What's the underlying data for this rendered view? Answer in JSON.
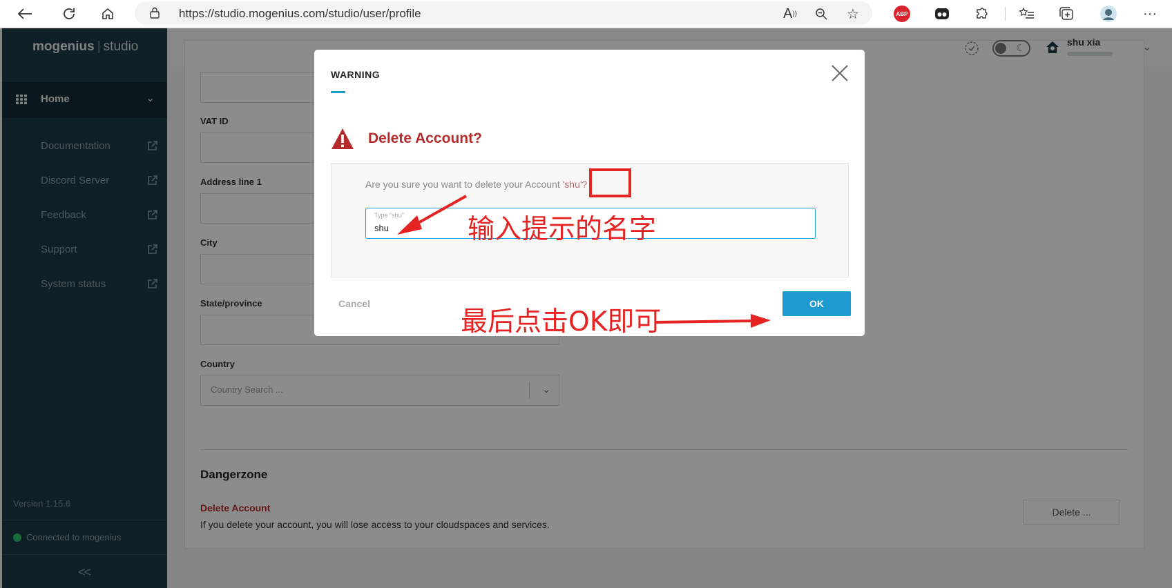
{
  "browser": {
    "url": "https://studio.mogenius.com/studio/user/profile"
  },
  "sidebar": {
    "brand": "mogenius",
    "brand_suffix": "studio",
    "home_label": "Home",
    "links": [
      {
        "label": "Documentation"
      },
      {
        "label": "Discord Server"
      },
      {
        "label": "Feedback"
      },
      {
        "label": "Support"
      },
      {
        "label": "System status"
      }
    ],
    "version": "Version 1.15.6",
    "status": "Connected to mogenius",
    "collapse": "<<"
  },
  "header": {
    "user_name": "shu xia"
  },
  "profile": {
    "labels": {
      "vat": "VAT ID",
      "address": "Address line 1",
      "city": "City",
      "state": "State/province",
      "country": "Country"
    },
    "country_placeholder": "Country Search ...",
    "dangerzone_title": "Dangerzone",
    "delete_title": "Delete Account",
    "delete_desc": "If you delete your account, you will lose access to your cloudspaces and services.",
    "delete_button": "Delete ..."
  },
  "modal": {
    "title": "WARNING",
    "heading": "Delete Account?",
    "question_prefix": "Are you sure you want to delete your Account ",
    "question_name": "'shu'?",
    "input_placeholder": "Type \"shu\"",
    "input_value": "shu",
    "cancel_label": "Cancel",
    "ok_label": "OK"
  },
  "annotations": {
    "input_hint": "输入提示的名字",
    "ok_hint": "最后点击OK即可"
  },
  "colors": {
    "sidebar": "#1b3a44",
    "accent": "#1d9bd1",
    "danger": "#b52b2b",
    "annotation": "#e52323"
  }
}
